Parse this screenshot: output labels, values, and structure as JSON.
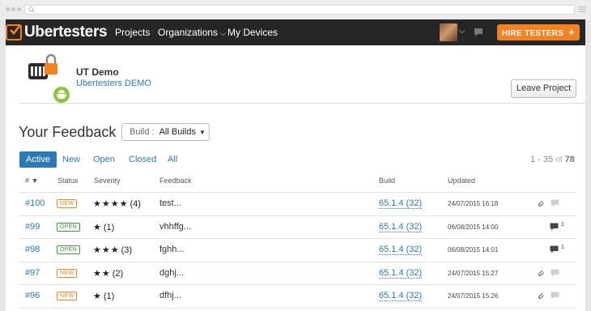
{
  "nav": {
    "brand": "Ubertesters",
    "links": [
      "Projects",
      "Organizations",
      "My Devices"
    ],
    "hire_label": "HIRE TESTERS",
    "hire_plus": "+"
  },
  "project": {
    "name": "UT Demo",
    "org": "Ubertesters DEMO",
    "leave_label": "Leave Project"
  },
  "feedback": {
    "title": "Your Feedback",
    "build_label": "Build :",
    "build_value": "All Builds"
  },
  "tabs": [
    "Active",
    "New",
    "Open",
    "Closed",
    "All"
  ],
  "paging": {
    "range": "1 - 35",
    "of": "of",
    "total": "78"
  },
  "columns": [
    "# ▼",
    "Status",
    "Severity",
    "Feedback",
    "Build",
    "Updated"
  ],
  "rows": [
    {
      "id": "#100",
      "status": "NEW",
      "stars": "★★★★",
      "count": "(4)",
      "feedback": "test...",
      "build": "65.1.4 (32)",
      "updated": "24/07/2015 16:18",
      "attach": true,
      "msg": ""
    },
    {
      "id": "#99",
      "status": "OPEN",
      "stars": "★",
      "count": "(1)",
      "feedback": "vhhffg...",
      "build": "65.1.4 (32)",
      "updated": "06/08/2015 14:00",
      "attach": false,
      "msg": "1"
    },
    {
      "id": "#98",
      "status": "OPEN",
      "stars": "★★★",
      "count": "(3)",
      "feedback": "fghh...",
      "build": "65.1.4 (32)",
      "updated": "06/08/2015 14:01",
      "attach": false,
      "msg": "1"
    },
    {
      "id": "#97",
      "status": "NEW",
      "stars": "★★",
      "count": "(2)",
      "feedback": "dghj...",
      "build": "65.1.4 (32)",
      "updated": "24/07/2015 15:27",
      "attach": true,
      "msg": ""
    },
    {
      "id": "#96",
      "status": "NEW",
      "stars": "★",
      "count": "(1)",
      "feedback": "dfhj...",
      "build": "65.1.4 (32)",
      "updated": "24/07/2015 15:26",
      "attach": true,
      "msg": ""
    }
  ],
  "colors": {
    "accent": "#f58220",
    "link": "#2a7ab8",
    "navbar": "#262626",
    "open": "#3a9a3a"
  }
}
